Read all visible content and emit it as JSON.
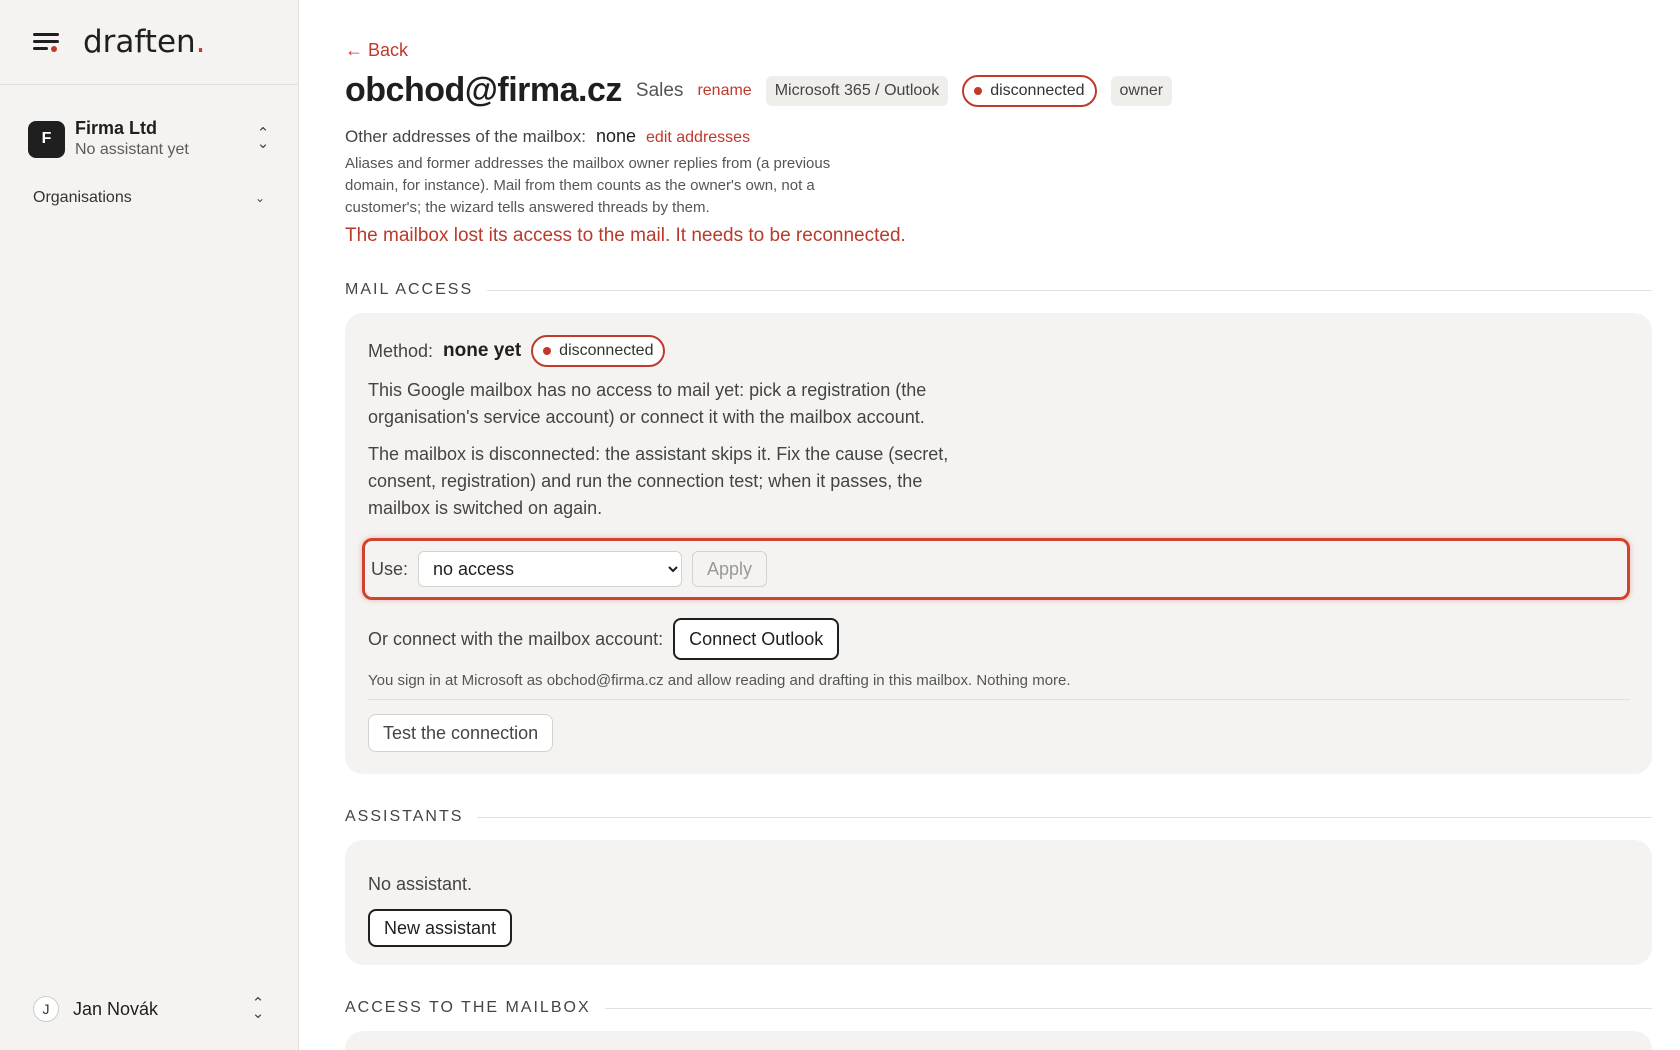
{
  "sidebar": {
    "logo": "draften",
    "logo_dot": ".",
    "org": {
      "initial": "F",
      "name": "Firma Ltd",
      "subtitle": "No assistant yet"
    },
    "nav_group": "Organisations",
    "user": {
      "initial": "J",
      "name": "Jan Novák"
    }
  },
  "header": {
    "back": "← Back",
    "mailbox": "obchod@firma.cz",
    "team": "Sales",
    "rename": "rename",
    "provider": "Microsoft 365 / Outlook",
    "status": "disconnected",
    "role": "owner"
  },
  "other_addresses": {
    "label": "Other addresses of the mailbox:",
    "value": "none",
    "edit": "edit addresses",
    "description": "Aliases and former addresses the mailbox owner replies from (a previous domain, for instance). Mail from them counts as the owner's own, not a customer's; the wizard tells answered threads by them."
  },
  "error": "The mailbox lost its access to the mail. It needs to be reconnected.",
  "mail_access": {
    "heading": "MAIL ACCESS",
    "method_label": "Method:",
    "method_value": "none yet",
    "method_status": "disconnected",
    "para1": "This Google mailbox has no access to mail yet: pick a registration (the organisation's service account) or connect it with the mailbox account.",
    "para2": "The mailbox is disconnected: the assistant skips it. Fix the cause (secret, consent, registration) and run the connection test; when it passes, the mailbox is switched on again.",
    "use_label": "Use:",
    "use_selected": "no access",
    "apply": "Apply",
    "connect_label": "Or connect with the mailbox account:",
    "connect_button": "Connect Outlook",
    "note": "You sign in at Microsoft as obchod@firma.cz and allow reading and drafting in this mailbox. Nothing more.",
    "test_button": "Test the connection"
  },
  "assistants": {
    "heading": "ASSISTANTS",
    "empty": "No assistant.",
    "new_button": "New assistant"
  },
  "access": {
    "heading": "ACCESS TO THE MAILBOX"
  }
}
